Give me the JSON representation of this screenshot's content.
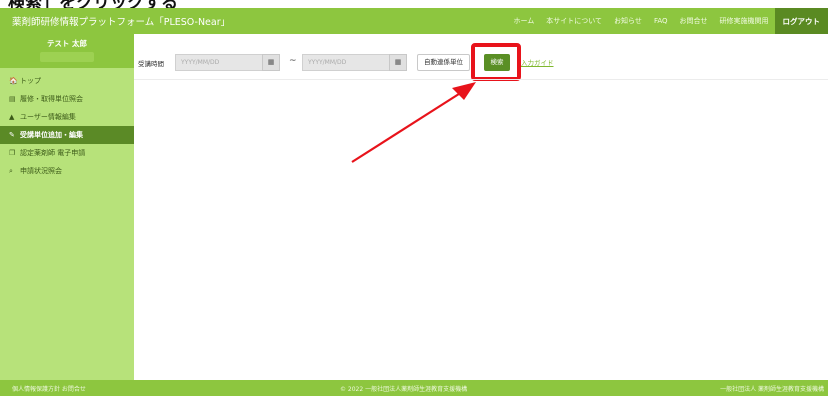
{
  "caption": "検索」をクリックする",
  "header": {
    "brand": "薬剤師研修情報プラットフォーム「PLESO-Near」",
    "nav": [
      "ホーム",
      "本サイトについて",
      "お知らせ",
      "FAQ",
      "お問合せ",
      "研修実施機関用"
    ],
    "logout": "ログアウト"
  },
  "sidebar": {
    "user_name": "テスト 太郎",
    "items": [
      {
        "icon": "home-icon",
        "glyph": "🏠",
        "label": "トップ",
        "active": false
      },
      {
        "icon": "id-card-icon",
        "glyph": "▤",
        "label": "履修・取得単位照会",
        "active": false
      },
      {
        "icon": "user-icon",
        "glyph": "▲",
        "label": "ユーザー情報編集",
        "active": false
      },
      {
        "icon": "edit-icon",
        "glyph": "✎",
        "label": "受講単位追加・編集",
        "active": true
      },
      {
        "icon": "copy-icon",
        "glyph": "❐",
        "label": "認定薬剤師 電子申請",
        "active": false
      },
      {
        "icon": "search-icon",
        "glyph": "⌕",
        "label": "申請状況照会",
        "active": false
      }
    ]
  },
  "filter": {
    "label": "受講時間",
    "start_placeholder": "YYYY/MM/DD",
    "end_placeholder": "YYYY/MM/DD",
    "separator": "~",
    "auto_button": "自動連係単位",
    "search_button": "検索",
    "guide_link": "入力ガイド"
  },
  "footer": {
    "left": "個人情報保護方針 お問合せ",
    "center": "© 2022 一般社団法人薬剤師生涯教育支援機構",
    "right": "一般社団法人 薬剤師生涯教育支援機構"
  },
  "colors": {
    "brand_green": "#8dc63f",
    "sidebar_green": "#b7e27a",
    "active_green": "#5b8a26",
    "annotation_red": "#e8131b"
  }
}
